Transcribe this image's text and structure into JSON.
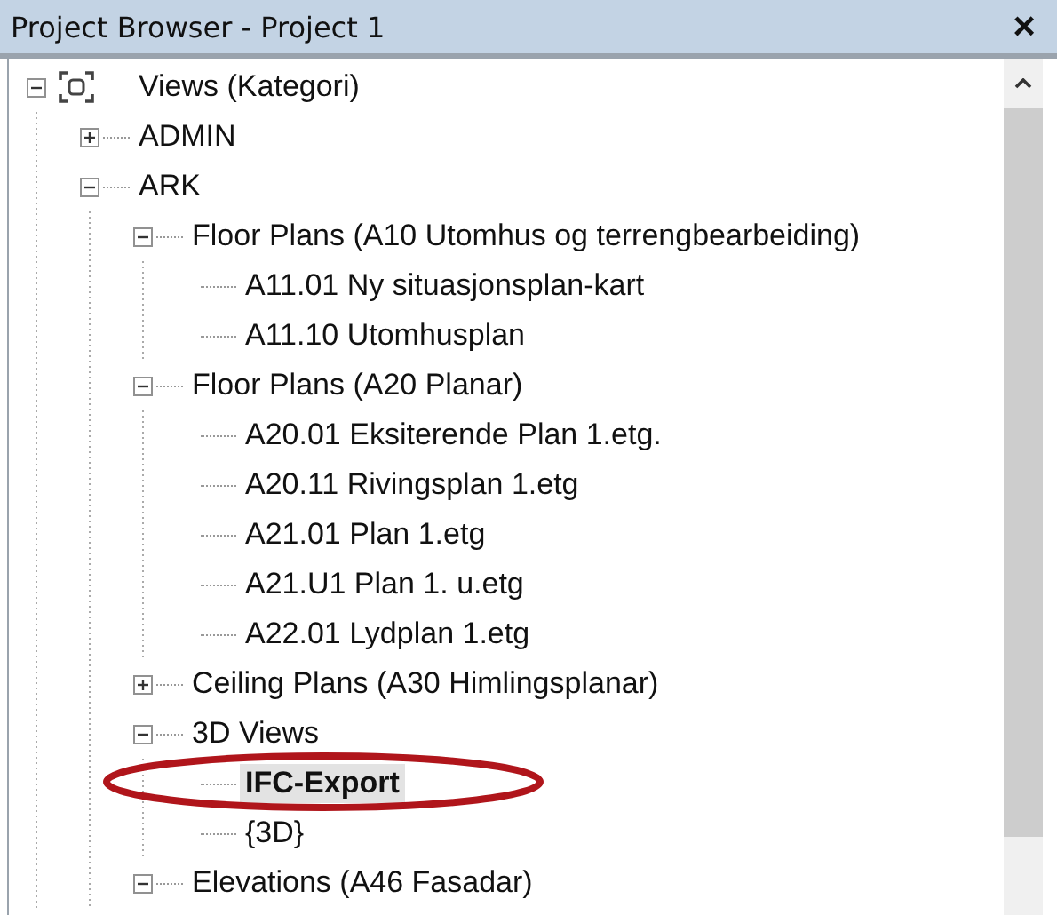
{
  "window": {
    "title": "Project Browser - Project 1",
    "close": "×"
  },
  "tree": [
    {
      "label": "Views (Kategori)",
      "kind": "root",
      "expanded": true,
      "selected": false,
      "children": [
        {
          "label": "ADMIN",
          "kind": "folder",
          "expanded": false,
          "selected": false
        },
        {
          "label": "ARK",
          "kind": "folder",
          "expanded": true,
          "selected": false,
          "children": [
            {
              "label": "Floor Plans (A10 Utomhus og terrengbearbeiding)",
              "kind": "folder",
              "expanded": true,
              "selected": false,
              "children": [
                {
                  "label": "A11.01 Ny situasjonsplan-kart",
                  "kind": "view",
                  "selected": false
                },
                {
                  "label": "A11.10 Utomhusplan",
                  "kind": "view",
                  "selected": false
                }
              ]
            },
            {
              "label": "Floor Plans (A20 Planar)",
              "kind": "folder",
              "expanded": true,
              "selected": false,
              "children": [
                {
                  "label": "A20.01 Eksiterende Plan 1.etg.",
                  "kind": "view",
                  "selected": false
                },
                {
                  "label": "A20.11 Rivingsplan 1.etg",
                  "kind": "view",
                  "selected": false
                },
                {
                  "label": "A21.01 Plan 1.etg",
                  "kind": "view",
                  "selected": false
                },
                {
                  "label": "A21.U1 Plan 1. u.etg",
                  "kind": "view",
                  "selected": false
                },
                {
                  "label": "A22.01 Lydplan 1.etg",
                  "kind": "view",
                  "selected": false
                }
              ]
            },
            {
              "label": "Ceiling Plans (A30 Himlingsplanar)",
              "kind": "folder",
              "expanded": false,
              "selected": false
            },
            {
              "label": "3D Views",
              "kind": "folder",
              "expanded": true,
              "selected": false,
              "children": [
                {
                  "label": "IFC-Export",
                  "kind": "view",
                  "selected": true
                },
                {
                  "label": "{3D}",
                  "kind": "view",
                  "selected": false
                }
              ]
            },
            {
              "label": "Elevations (A46 Fasadar)",
              "kind": "folder",
              "expanded": true,
              "selected": false
            }
          ]
        }
      ]
    }
  ]
}
